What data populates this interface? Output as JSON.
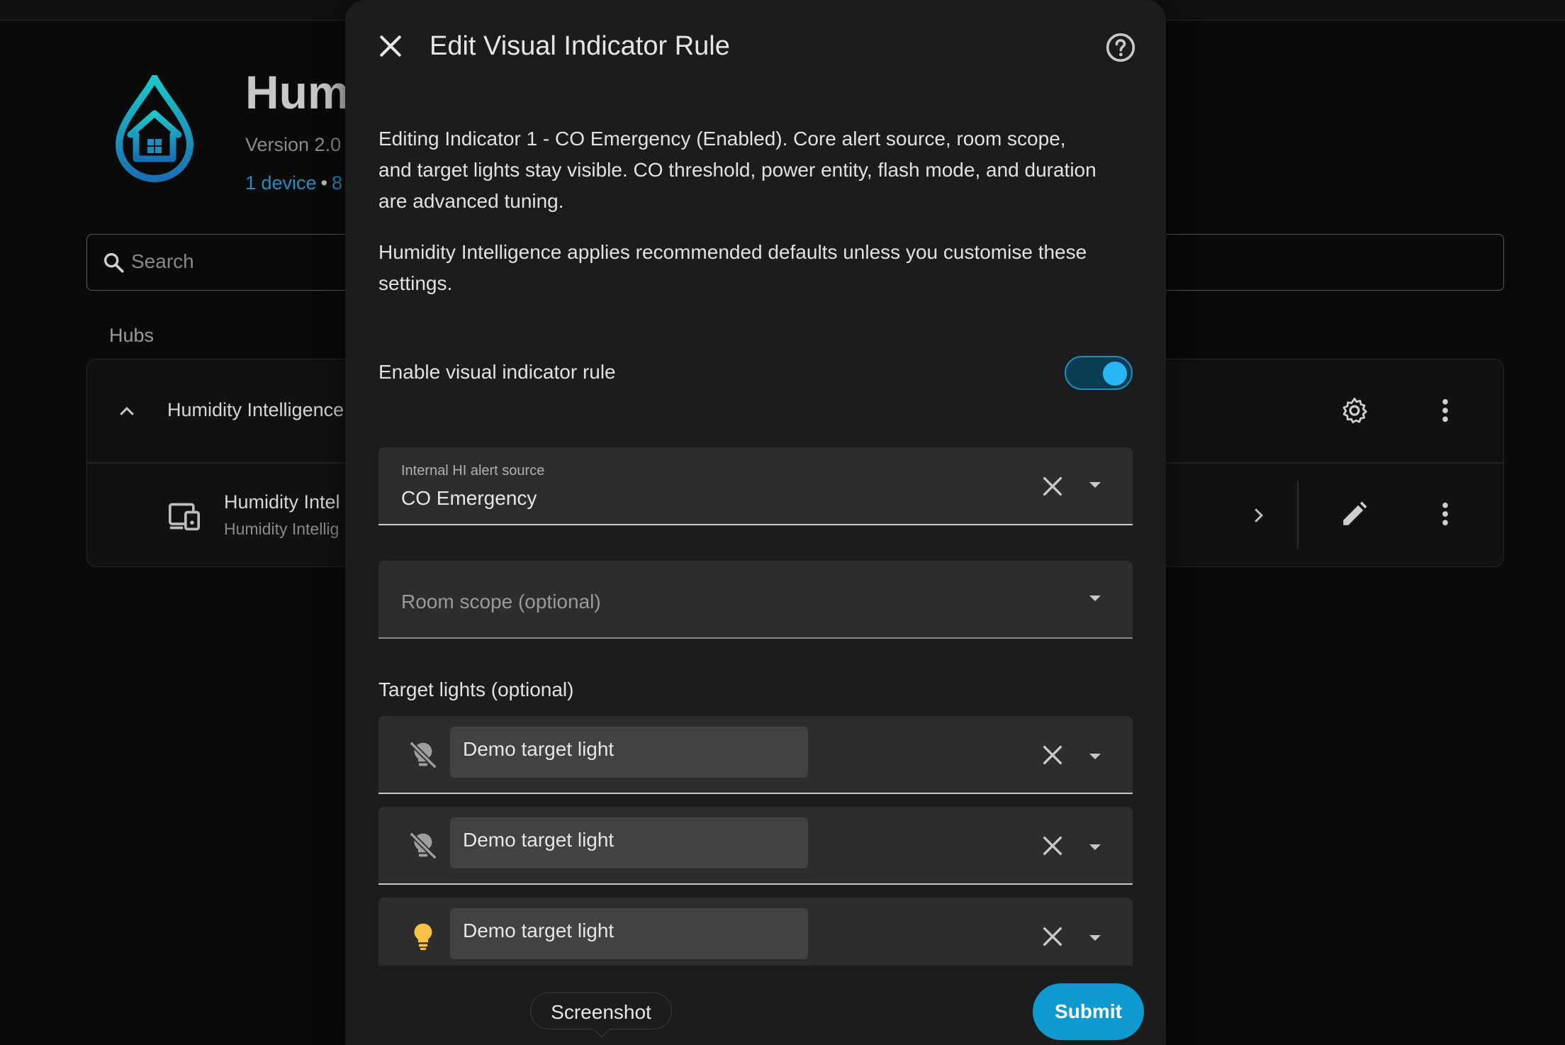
{
  "background": {
    "app_title": "Humi",
    "version": "Version 2.0",
    "devices_link": "1 device",
    "devices_link_tail": "8",
    "search_placeholder": "Search",
    "section_title": "Hubs",
    "hub_row_label": "Humidity Intelligence",
    "device_row_title": "Humidity Intel",
    "device_row_subtitle": "Humidity Intellig"
  },
  "dialog": {
    "title": "Edit Visual Indicator Rule",
    "description": "Editing Indicator 1 - CO Emergency (Enabled). Core alert source, room scope, and target lights stay visible. CO threshold, power entity, flash mode, and duration are advanced tuning.",
    "defaults_note": "Humidity Intelligence applies recommended defaults unless you customise these settings.",
    "enable_toggle": {
      "label": "Enable visual indicator rule",
      "checked": true
    },
    "alert_source": {
      "label": "Internal HI alert source",
      "value": "CO Emergency"
    },
    "room_scope": {
      "placeholder": "Room scope (optional)"
    },
    "target_lights": {
      "label": "Target lights (optional)",
      "items": [
        {
          "name": "Demo target light",
          "state": "off"
        },
        {
          "name": "Demo target light",
          "state": "off"
        },
        {
          "name": "Demo target light",
          "state": "on"
        }
      ]
    },
    "screenshot_tooltip": "Screenshot",
    "submit_label": "Submit"
  },
  "colors": {
    "accent": "#0d9ad1",
    "toggle_on": "#29b6f6",
    "light_on": "#f9c046",
    "background": "#0a0a0a",
    "dialog_bg": "#1c1c1c"
  },
  "icons": {
    "close": "close-icon",
    "help": "help-circle-icon",
    "clear": "clear-icon",
    "dropdown": "caret-down-icon",
    "light_off": "lightbulb-off-icon",
    "light_on": "lightbulb-on-icon"
  }
}
